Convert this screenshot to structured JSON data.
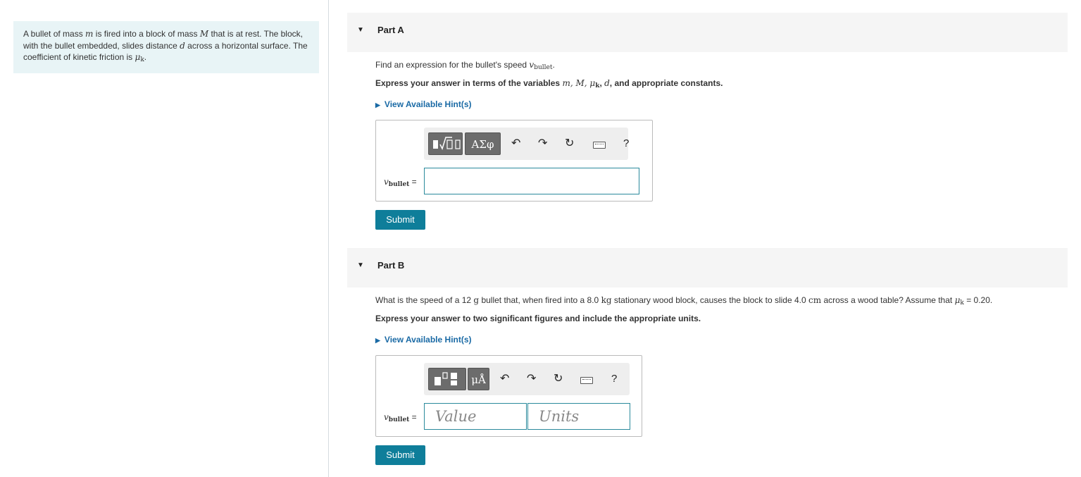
{
  "problem": {
    "text_1": "A bullet of mass ",
    "m": "m",
    "text_2": " is fired into a block of mass ",
    "M": "M",
    "text_3": " that is at rest. The block, with the bullet embedded, slides distance ",
    "d": "d",
    "text_4": " across a horizontal surface. The coefficient of kinetic friction is ",
    "mu": "μ",
    "mu_sub": "k",
    "text_5": "."
  },
  "part_a": {
    "title": "Part A",
    "question_1": "Find an expression for the bullet's speed ",
    "var": "v",
    "var_sub": "bullet",
    "question_end": ".",
    "instr_1": "Express your answer in terms of the variables ",
    "instr_vars": "m, M, μ",
    "instr_mu_sub": "k",
    "instr_2": ", ",
    "instr_d": "d",
    "instr_3": ", and appropriate constants.",
    "hint": "View Available Hint(s)",
    "toolbar_btn2": "ΑΣφ",
    "help": "?",
    "label_var": "v",
    "label_sub": "bullet",
    "label_eq": " =",
    "submit": "Submit"
  },
  "part_b": {
    "title": "Part B",
    "q1": "What is the speed of a 12 ",
    "g": "g",
    "q2": " bullet that, when fired into a 8.0 ",
    "kg": "kg",
    "q3": " stationary wood block, causes the block to slide 4.0 ",
    "cm": "cm",
    "q4": " across a wood table? Assume that ",
    "mu": "μ",
    "mu_sub": "k",
    "q5": " = 0.20.",
    "instr": "Express your answer to two significant figures and include the appropriate units.",
    "hint": "View Available Hint(s)",
    "toolbar_btn2": "μÅ",
    "help": "?",
    "label_var": "v",
    "label_sub": "bullet",
    "label_eq": " =",
    "value_placeholder": "Value",
    "units_placeholder": "Units",
    "submit": "Submit"
  }
}
